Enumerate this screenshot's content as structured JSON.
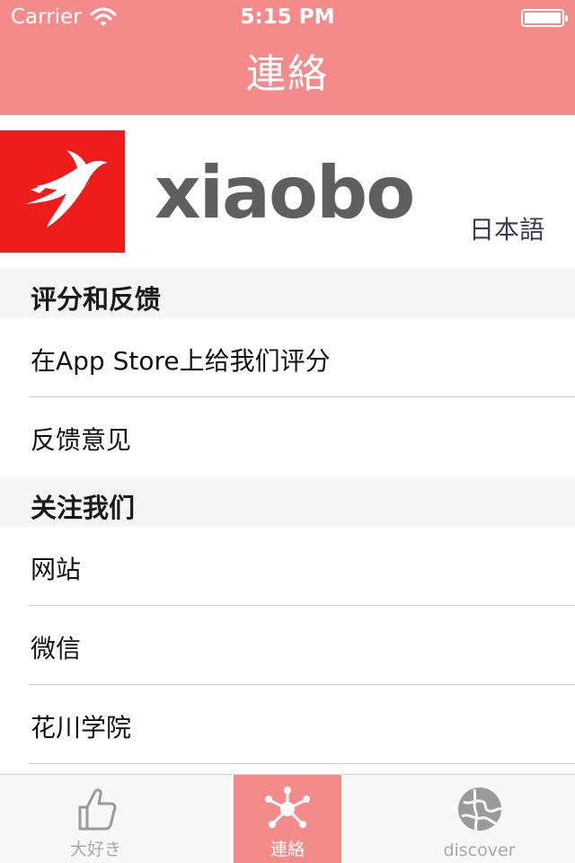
{
  "status_bar": {
    "carrier": "Carrier",
    "time": "5:15 PM"
  },
  "nav": {
    "title": "連絡"
  },
  "banner": {
    "logo_text": "xiaobo",
    "language": "日本語"
  },
  "sections": [
    {
      "header": "评分和反馈",
      "rows": [
        "在App Store上给我们评分",
        "反馈意见"
      ]
    },
    {
      "header": "关注我们",
      "rows": [
        "网站",
        "微信",
        "花川学院"
      ]
    }
  ],
  "tabs": [
    {
      "label": "大好き",
      "icon": "thumbs-up-icon",
      "active": false
    },
    {
      "label": "連絡",
      "icon": "network-icon",
      "active": true
    },
    {
      "label": "discover",
      "icon": "globe-icon",
      "active": false
    }
  ],
  "colors": {
    "accent": "#f38b8a",
    "logo_red": "#ef1c1c"
  }
}
